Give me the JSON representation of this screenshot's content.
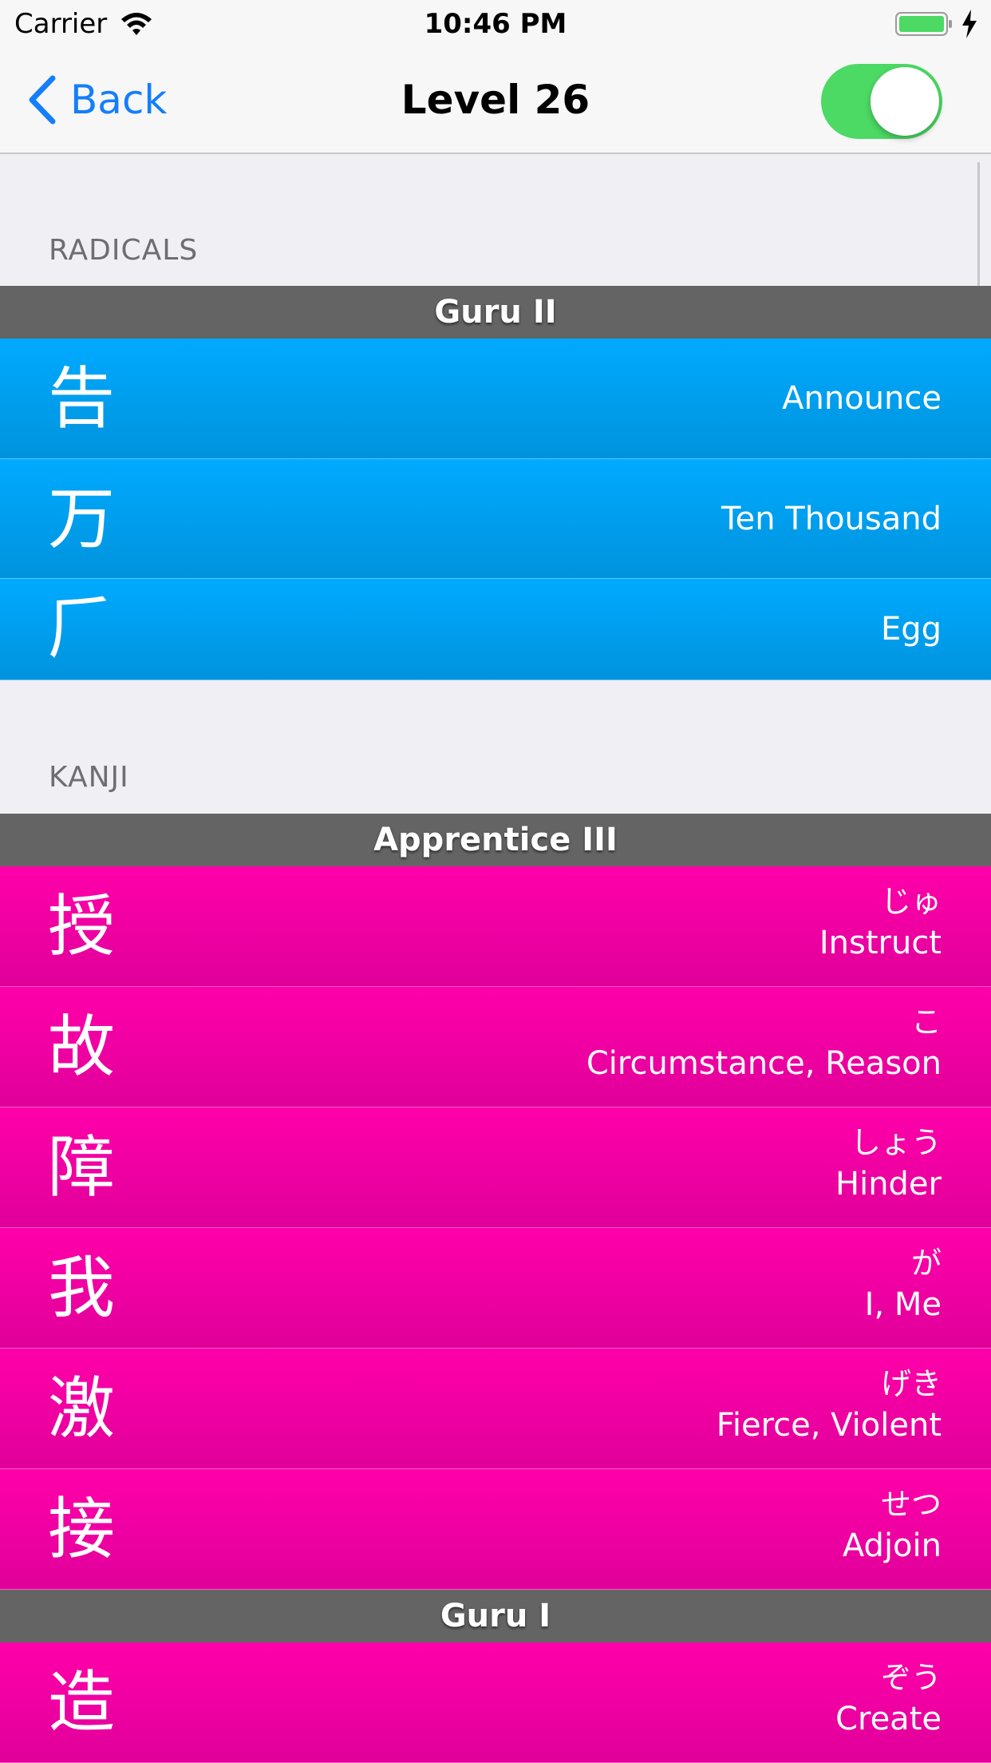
{
  "status_bar": {
    "carrier": "Carrier",
    "time": "10:46 PM"
  },
  "nav": {
    "back_label": "Back",
    "title": "Level 26",
    "toggle_on": true
  },
  "colors": {
    "radical": "#00a3f5",
    "kanji": "#f500a8",
    "srs_header": "#646464",
    "toggle": "#4cd964",
    "tint": "#147efb"
  },
  "sections": {
    "radicals_header": "RADICALS",
    "kanji_header": "KANJI"
  },
  "radicals": {
    "srs_label": "Guru II",
    "items": [
      {
        "character": "告",
        "meaning": "Announce"
      },
      {
        "character": "万",
        "meaning": "Ten Thousand"
      },
      {
        "character": "𠂆",
        "meaning": "Egg"
      }
    ]
  },
  "kanji": {
    "groups": [
      {
        "srs_label": "Apprentice III",
        "items": [
          {
            "character": "授",
            "reading": "じゅ",
            "meaning": "Instruct"
          },
          {
            "character": "故",
            "reading": "こ",
            "meaning": "Circumstance, Reason"
          },
          {
            "character": "障",
            "reading": "しょう",
            "meaning": "Hinder"
          },
          {
            "character": "我",
            "reading": "が",
            "meaning": "I, Me"
          },
          {
            "character": "激",
            "reading": "げき",
            "meaning": "Fierce, Violent"
          },
          {
            "character": "接",
            "reading": "せつ",
            "meaning": "Adjoin"
          }
        ]
      },
      {
        "srs_label": "Guru I",
        "items": [
          {
            "character": "造",
            "reading": "ぞう",
            "meaning": "Create"
          }
        ]
      }
    ]
  }
}
